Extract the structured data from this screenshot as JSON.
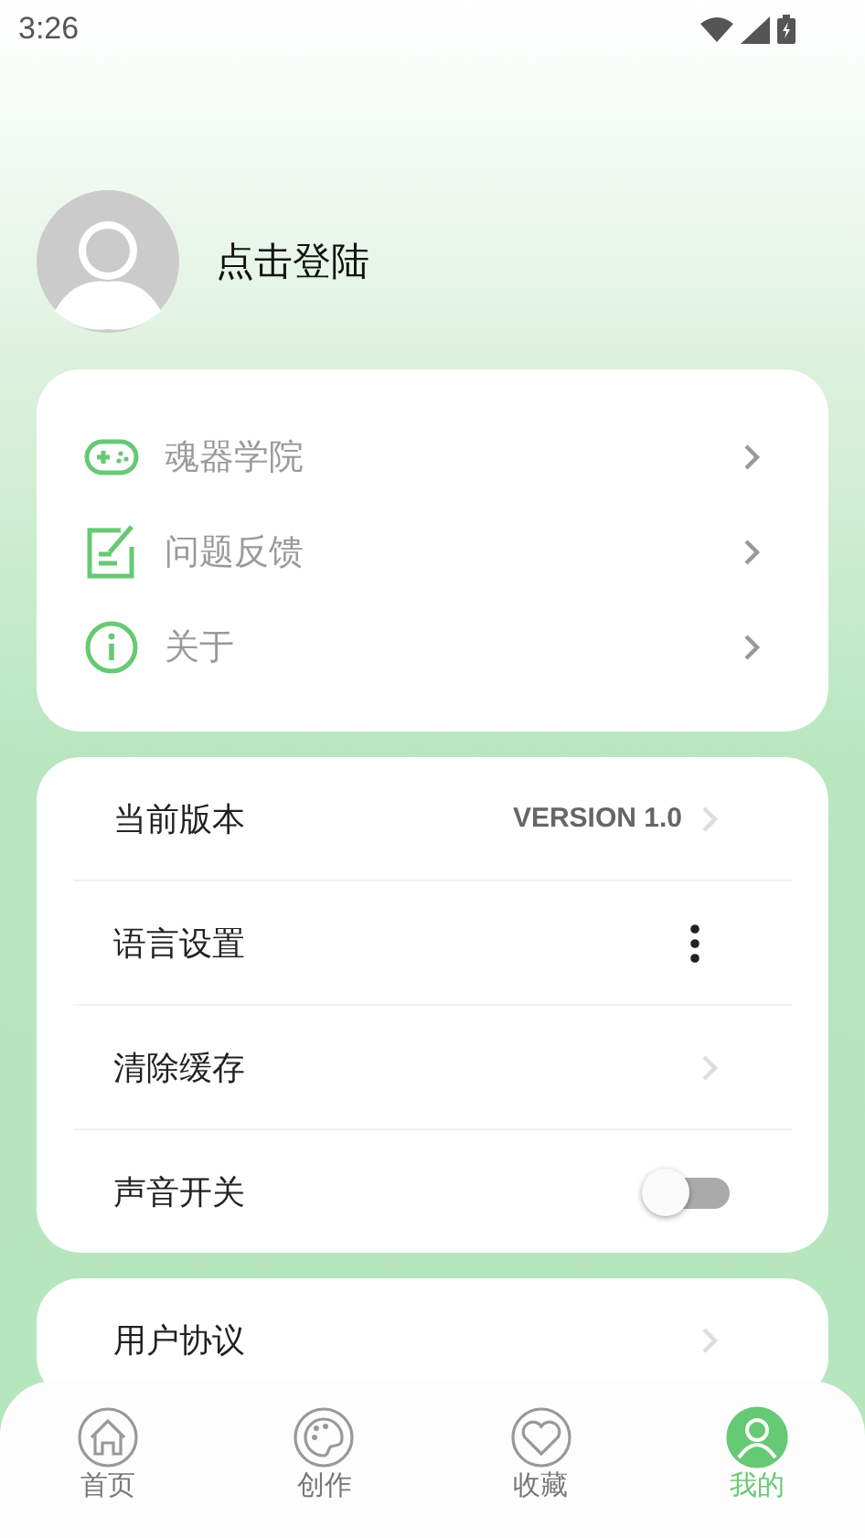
{
  "status_bar": {
    "time": "3:26"
  },
  "profile": {
    "name": "点击登陆"
  },
  "menu": [
    {
      "label": "魂器学院",
      "kind": "gamepad"
    },
    {
      "label": "问题反馈",
      "kind": "note"
    },
    {
      "label": "关于",
      "kind": "info"
    }
  ],
  "settings": [
    {
      "label": "当前版本",
      "kind": "value",
      "value": "VERSION 1.0"
    },
    {
      "label": "语言设置",
      "kind": "more"
    },
    {
      "label": "清除缓存",
      "kind": "chevron"
    },
    {
      "label": "声音开关",
      "kind": "toggle",
      "on": false
    }
  ],
  "more_settings": [
    {
      "label": "用户协议",
      "kind": "chevron"
    }
  ],
  "tabs": [
    {
      "label": "首页",
      "kind": "home",
      "selected": false
    },
    {
      "label": "创作",
      "kind": "palette",
      "selected": false
    },
    {
      "label": "收藏",
      "kind": "heart",
      "selected": false
    },
    {
      "label": "我的",
      "kind": "person",
      "selected": true
    }
  ]
}
